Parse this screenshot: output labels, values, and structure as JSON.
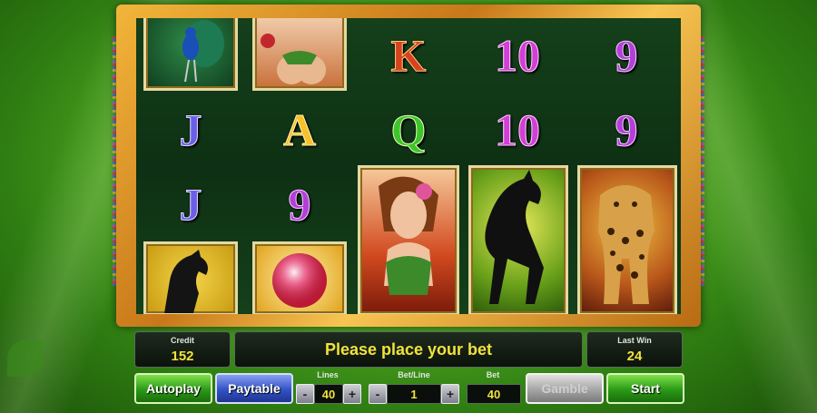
{
  "credit": {
    "label": "Credit",
    "value": "152"
  },
  "message": "Please place your bet",
  "last_win": {
    "label": "Last Win",
    "value": "24"
  },
  "buttons": {
    "autoplay": "Autoplay",
    "paytable": "Paytable",
    "gamble": "Gamble",
    "start": "Start",
    "minus": "-",
    "plus": "+"
  },
  "lines": {
    "label": "Lines",
    "value": "40"
  },
  "bet_line": {
    "label": "Bet/Line",
    "value": "1"
  },
  "bet": {
    "label": "Bet",
    "value": "40"
  },
  "reels": {
    "r1": [
      "peacock",
      "J",
      "J",
      "black-horse"
    ],
    "r2": [
      "woman-portrait",
      "A",
      "9",
      "crystal-ball"
    ],
    "r3": [
      "K",
      "Q",
      "woman-portrait"
    ],
    "r4": [
      "10",
      "10",
      "black-horse"
    ],
    "r5": [
      "9",
      "9",
      "leopard"
    ]
  },
  "symbols": {
    "J": "J",
    "A": "A",
    "K": "K",
    "Q": "Q",
    "nine": "9",
    "ten": "10"
  },
  "colors": {
    "accent_green": "#2a9a16",
    "accent_blue": "#3152c7",
    "text_yellow": "#f0e33a",
    "frame_gold": "#f2b53a"
  }
}
